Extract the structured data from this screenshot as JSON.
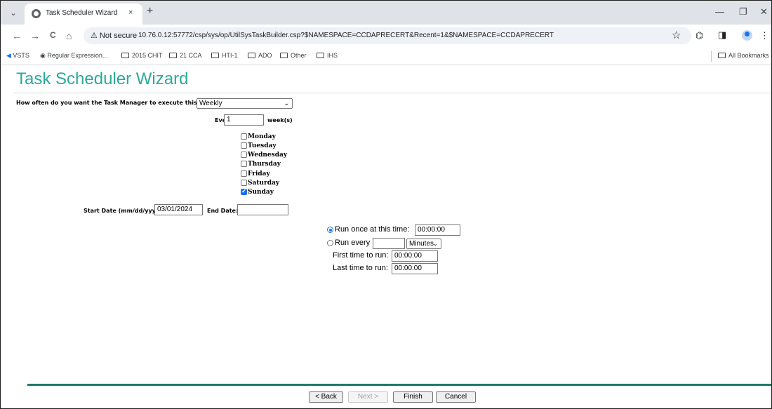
{
  "browser": {
    "tab": {
      "title": "Task Scheduler Wizard",
      "close": "×"
    },
    "new_tab": "+",
    "window_controls": {
      "minimize": "—",
      "restore": "❐",
      "close": "✕"
    },
    "nav": {
      "back": "←",
      "forward": "→",
      "reload": "C",
      "home": "⌂"
    },
    "security_label": "⚠ Not secure",
    "url": "10.76.0.12:57772/csp/sys/op/UtilSysTaskBuilder.csp?$NAMESPACE=CCDAPRECERT&Recent=1&$NAMESPACE=CCDAPRECERT",
    "bookmark_star": "☆",
    "menu": "⋮",
    "bookmarks": [
      "VSTS",
      "Regular Expression...",
      "2015 CHIT",
      "21 CCA",
      "HTI-1",
      "ADO",
      "Other",
      "IHS"
    ],
    "all_bookmarks": "All Bookmarks"
  },
  "page": {
    "title": "Task Scheduler Wizard",
    "frequency": {
      "label": "How often do you want the Task Manager to execute this task?",
      "selected": "Weekly"
    },
    "every": {
      "label": "Every",
      "value": "1",
      "unit": "week(s)"
    },
    "days": [
      {
        "label": "Monday",
        "checked": false
      },
      {
        "label": "Tuesday",
        "checked": false
      },
      {
        "label": "Wednesday",
        "checked": false
      },
      {
        "label": "Thursday",
        "checked": false
      },
      {
        "label": "Friday",
        "checked": false
      },
      {
        "label": "Saturday",
        "checked": false
      },
      {
        "label": "Sunday",
        "checked": true
      }
    ],
    "start_date": {
      "label": "Start Date (mm/dd/yyyy):",
      "value": "03/01/2024"
    },
    "end_date": {
      "label": "End Date:",
      "value": ""
    },
    "run_once": {
      "label": "Run once at this time:",
      "value": "00:00:00",
      "selected": true
    },
    "run_every": {
      "label": "Run every",
      "value": "",
      "unit": "Minutes",
      "selected": false
    },
    "first_time": {
      "label": "First time to run:",
      "value": "00:00:00"
    },
    "last_time": {
      "label": "Last time to run:",
      "value": "00:00:00"
    }
  },
  "footer": {
    "back": "< Back",
    "next": "Next >",
    "finish": "Finish",
    "cancel": "Cancel"
  },
  "colors": {
    "title": "#2aaa9a",
    "footer_rule": "#1e7a6a",
    "check": "#1a73e8"
  }
}
